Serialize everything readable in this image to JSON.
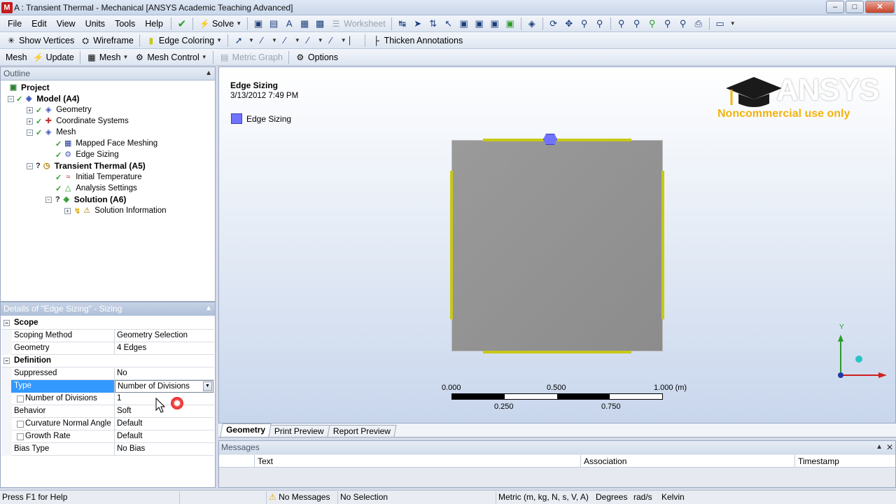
{
  "window": {
    "title": "A : Transient Thermal - Mechanical [ANSYS Academic Teaching Advanced]",
    "app_icon_label": "M"
  },
  "menu": [
    "File",
    "Edit",
    "View",
    "Units",
    "Tools",
    "Help"
  ],
  "toolbar1": {
    "solve": "Solve",
    "worksheet": "Worksheet"
  },
  "toolbar2": {
    "show_vertices": "Show Vertices",
    "wireframe": "Wireframe",
    "edge_coloring": "Edge Coloring",
    "thicken_annotations": "Thicken Annotations"
  },
  "toolbar3": {
    "mesh": "Mesh",
    "update": "Update",
    "mesh_menu": "Mesh",
    "mesh_control": "Mesh Control",
    "metric_graph": "Metric Graph",
    "options": "Options"
  },
  "outline": {
    "header": "Outline",
    "items": [
      {
        "label": "Project"
      },
      {
        "label": "Model (A4)"
      },
      {
        "label": "Geometry"
      },
      {
        "label": "Coordinate Systems"
      },
      {
        "label": "Mesh"
      },
      {
        "label": "Mapped Face Meshing"
      },
      {
        "label": "Edge Sizing"
      },
      {
        "label": "Transient Thermal (A5)"
      },
      {
        "label": "Initial Temperature"
      },
      {
        "label": "Analysis Settings"
      },
      {
        "label": "Solution (A6)"
      },
      {
        "label": "Solution Information"
      }
    ]
  },
  "details": {
    "header": "Details of \"Edge Sizing\" - Sizing",
    "rows": [
      {
        "label": "Scope",
        "value": ""
      },
      {
        "label": "Scoping Method",
        "value": "Geometry Selection"
      },
      {
        "label": "Geometry",
        "value": "4 Edges"
      },
      {
        "label": "Definition",
        "value": ""
      },
      {
        "label": "Suppressed",
        "value": "No"
      },
      {
        "label": "Type",
        "value": "Number of Divisions"
      },
      {
        "label": "Number of Divisions",
        "value": "1"
      },
      {
        "label": "Behavior",
        "value": "Soft"
      },
      {
        "label": "Curvature Normal Angle",
        "value": "Default"
      },
      {
        "label": "Growth Rate",
        "value": "Default"
      },
      {
        "label": "Bias Type",
        "value": "No Bias"
      }
    ]
  },
  "viewport": {
    "title": "Edge Sizing",
    "date": "3/13/2012 7:49 PM",
    "legend": "Edge Sizing",
    "logo": "ANSYS",
    "logo_sub": "Noncommercial use only",
    "scale": {
      "l0": "0.000",
      "l1": "0.500",
      "l2": "1.000 (m)",
      "l3": "0.250",
      "l4": "0.750"
    },
    "triad_y": "Y",
    "colors": {
      "edge": "#c8c818",
      "selection": "#6f73ff",
      "accent": "#3399ff"
    }
  },
  "tabs": [
    "Geometry",
    "Print Preview",
    "Report Preview"
  ],
  "messages": {
    "header": "Messages",
    "cols": [
      "Text",
      "Association",
      "Timestamp"
    ]
  },
  "status": {
    "help": "Press F1 for Help",
    "messages": "No Messages",
    "selection": "No Selection",
    "units": "Metric (m, kg, N, s, V, A)",
    "angle": "Degrees",
    "rate": "rad/s",
    "temp": "Kelvin"
  }
}
